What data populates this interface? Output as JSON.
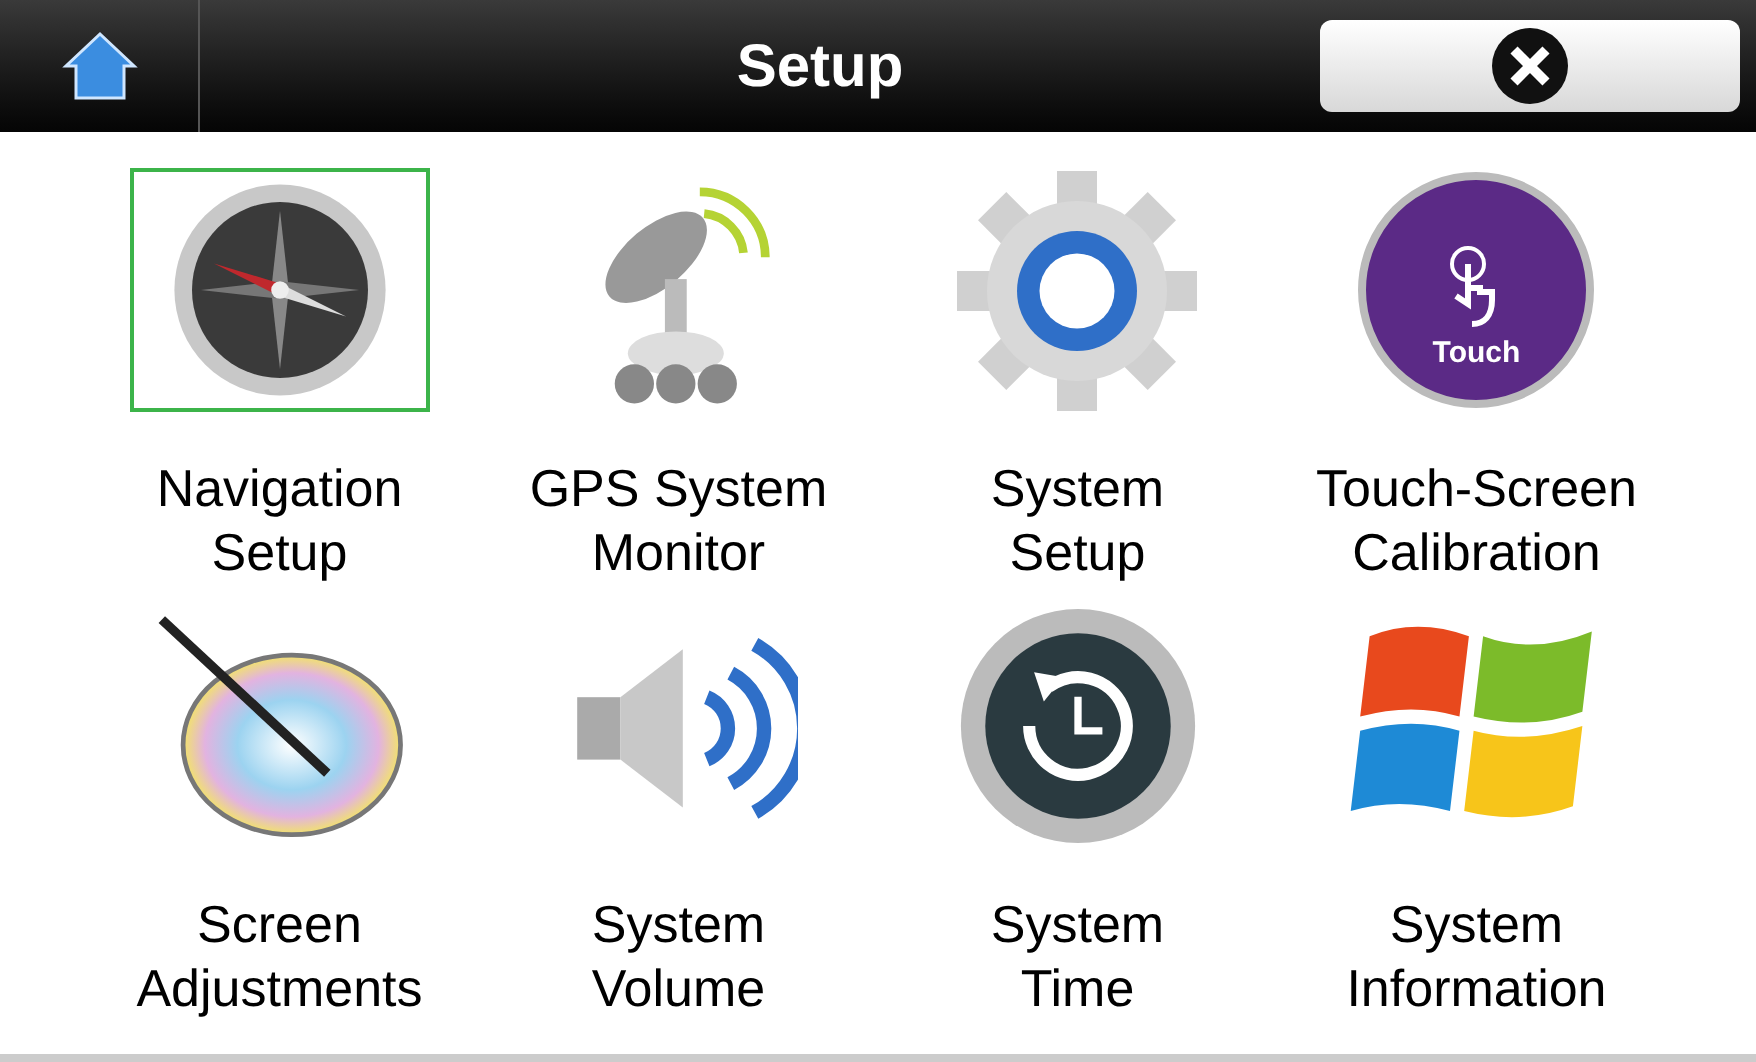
{
  "header": {
    "title": "Setup"
  },
  "items": [
    {
      "kind": "compass",
      "label": "Navigation\nSetup",
      "selected": true
    },
    {
      "kind": "satellite",
      "label": "GPS System\nMonitor",
      "selected": false
    },
    {
      "kind": "gear",
      "label": "System\nSetup",
      "selected": false
    },
    {
      "kind": "touch",
      "label": "Touch-Screen\nCalibration",
      "selected": false,
      "icon_text": "Touch"
    },
    {
      "kind": "palette",
      "label": "Screen\nAdjustments",
      "selected": false
    },
    {
      "kind": "speaker",
      "label": "System\nVolume",
      "selected": false
    },
    {
      "kind": "clock",
      "label": "System\nTime",
      "selected": false
    },
    {
      "kind": "windows",
      "label": "System\nInformation",
      "selected": false
    }
  ]
}
